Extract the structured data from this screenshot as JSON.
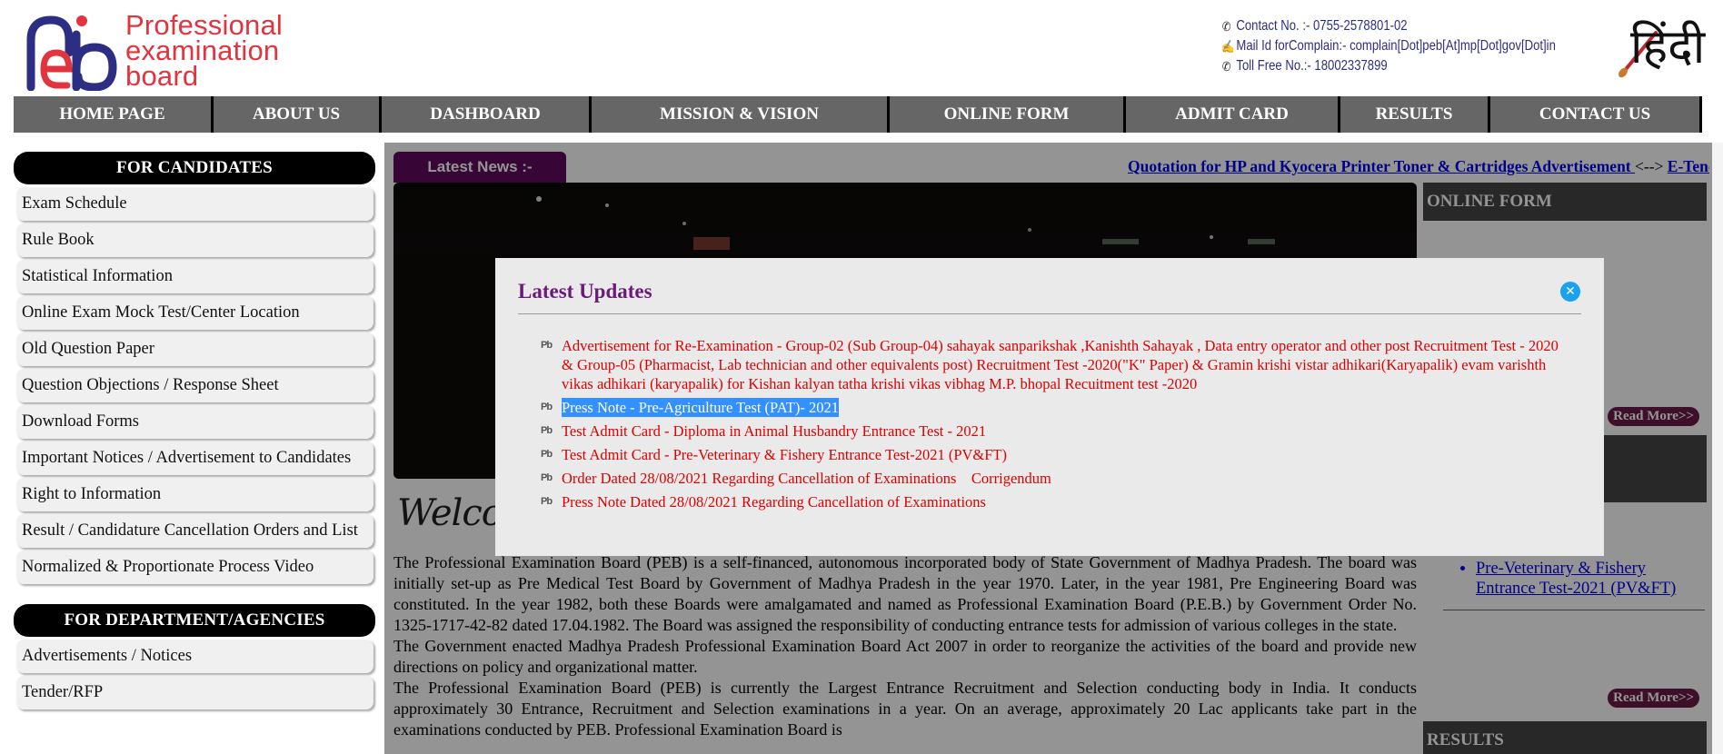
{
  "header": {
    "logo_text": [
      "Professional",
      "examination",
      "board"
    ],
    "contact_no": "Contact No. :- 0755-2578801-02",
    "complaint_mail": "Mail Id forComplain:- complain[Dot]peb[At]mp[Dot]gov[Dot]in",
    "toll_free": "Toll Free No.:- 18002337899",
    "language_toggle": "हिंदी",
    "icons": {
      "phone": "phone-icon",
      "mail": "mail-icon",
      "language": "brush-icon"
    }
  },
  "nav": [
    {
      "label": "HOME PAGE"
    },
    {
      "label": "ABOUT US"
    },
    {
      "label": "DASHBOARD"
    },
    {
      "label": "MISSION & VISION"
    },
    {
      "label": "ONLINE FORM"
    },
    {
      "label": "ADMIT CARD"
    },
    {
      "label": "RESULTS"
    },
    {
      "label": "CONTACT US"
    }
  ],
  "sidebar": {
    "candidates_title": "FOR CANDIDATES",
    "candidates_items": [
      "Exam Schedule",
      "Rule Book",
      "Statistical Information",
      "Online Exam Mock Test/Center Location",
      "Old Question Paper",
      "Question Objections / Response Sheet",
      "Download Forms",
      "Important Notices / Advertisement to Candidates",
      "Right to Information",
      "Result / Candidature Cancellation Orders and List",
      "Normalized & Proportionate Process Video"
    ],
    "department_title": "FOR DEPARTMENT/AGENCIES",
    "department_items": [
      "Advertisements / Notices",
      "Tender/RFP"
    ]
  },
  "ticker": {
    "label": "Latest News :-",
    "link1": "Quotation for HP and Kyocera Printer Toner & Cartridges Advertisement ",
    "separator": "<--> ",
    "link2": "E-Tender"
  },
  "welcome_heading": "Welcome",
  "about": [
    "The Professional Examination Board (PEB) is a self-financed, autonomous incorporated body of State Government of Madhya Pradesh. The board was initially set-up as Pre Medical Test Board by Government of Madhya Pradesh in the year 1970. Later, in the year 1981, Pre Engineering Board was constituted. In the year 1982, both these Boards were amalgamated and named as Professional Examination Board (P.E.B.) by Government Order No. 1325-1717-42-82 dated 17.04.1982. The Board was assigned the responsibility of conducting entrance tests for admission of various colleges in the state.",
    "The Government enacted Madhya Pradesh Professional Examination Board Act 2007 in order to reorganize the activities of the board and provide new directions on policy and organizational matter.",
    "The Professional Examination Board (PEB) is currently the Largest Entrance Recruitment and Selection conducting body in India. It conducts approximately 30 Entrance, Recruitment and Selection examinations in a year. On an average, approximately 20 Lac applicants take part in the examinations conducted by PEB. Professional Examination Board is"
  ],
  "right_column": {
    "online_form_title": "ONLINE FORM",
    "read_more": "Read More>>",
    "admit_link": "Pre-Veterinary & Fishery Entrance Test-2021 (PV&FT)",
    "results_title": "RESULTS"
  },
  "modal": {
    "title": "Latest Updates",
    "close_icon": "close-icon",
    "bullet_glyph": "Pb",
    "items": [
      {
        "text": "Advertisement for Re-Examination -  Group-02 (Sub Group-04) sahayak sanparikshak ,Kanishth Sahayak , Data entry operator and other post Recruitment Test - 2020 & Group-05 (Pharmacist, Lab technician and other equivalents post) Recruitment Test -2020(\"K\" Paper) & Gramin krishi vistar adhikari(Karyapalik) evam varishth vikas adhikari (karyapalik) for Kishan kalyan tatha krishi vikas vibhag M.P. bhopal Recuitment test -2020",
        "selected": false
      },
      {
        "text": "Press Note - Pre-Agriculture Test (PAT)- 2021",
        "selected": true
      },
      {
        "text": "Test Admit Card - Diploma in Animal Husbandry Entrance Test - 2021",
        "selected": false
      },
      {
        "text": "Test Admit Card - Pre-Veterinary & Fishery Entrance Test-2021 (PV&FT)",
        "selected": false
      },
      {
        "text": "Order Dated 28/08/2021 Regarding Cancellation of Examinations    Corrigendum",
        "selected": false
      },
      {
        "text": "Press Note Dated 28/08/2021 Regarding Cancellation of Examinations",
        "selected": false
      }
    ]
  },
  "colors": {
    "nav_bg": "#666666",
    "brand_red": "#e1343f",
    "brand_blue": "#2b2e83",
    "news_label": "#600c5e",
    "modal_title": "#6b1a7a",
    "modal_link": "#e00000",
    "close_button": "#1ba1f2",
    "read_more": "#6c1a46"
  }
}
